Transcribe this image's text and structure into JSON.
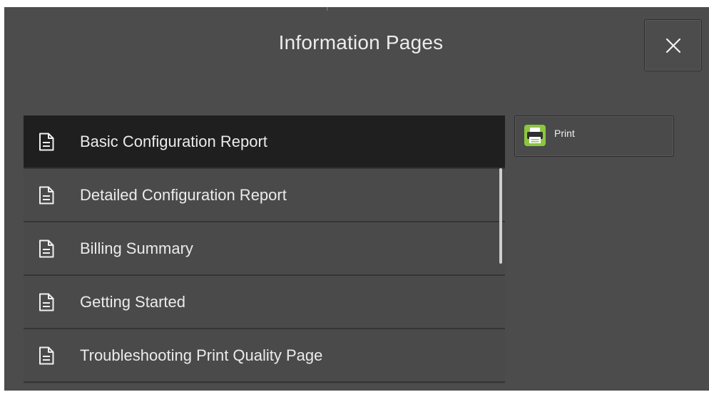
{
  "dialog": {
    "title": "Information Pages",
    "close_icon": "close-icon"
  },
  "pages": {
    "items": [
      {
        "label": "Basic Configuration Report",
        "icon": "document-icon",
        "selected": true
      },
      {
        "label": "Detailed Configuration Report",
        "icon": "document-icon",
        "selected": false
      },
      {
        "label": "Billing Summary",
        "icon": "document-icon",
        "selected": false
      },
      {
        "label": "Getting Started",
        "icon": "document-icon",
        "selected": false
      },
      {
        "label": "Troubleshooting Print Quality Page",
        "icon": "document-icon",
        "selected": false
      }
    ]
  },
  "actions": {
    "print_label": "Print",
    "print_icon": "printer-icon"
  },
  "colors": {
    "background": "#4c4c4c",
    "selected_row": "#1f1f1f",
    "print_icon_green": "#8cc63f"
  }
}
